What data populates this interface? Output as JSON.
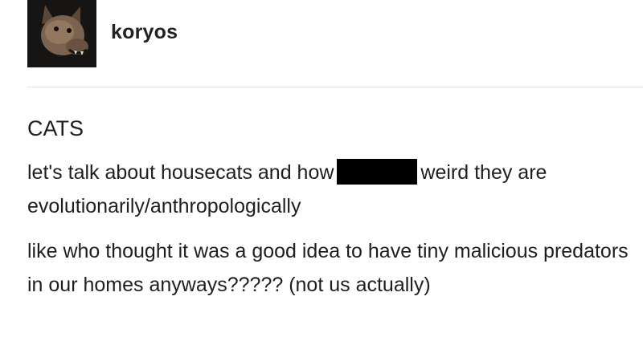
{
  "post": {
    "author": {
      "username": "koryos",
      "avatar_icon": "bat-avatar-icon"
    },
    "heading": "CATS",
    "paragraph1": {
      "before_redaction": "let's talk about housecats and how",
      "after_redaction": "weird they are evolutionarily/anthropologically"
    },
    "paragraph2": "like who thought it was a good idea to have tiny malicious predators in our homes anyways????? (not us actually)"
  },
  "colors": {
    "text": "#1e1e1e",
    "divider": "#e2e2e2",
    "redaction": "#000000"
  }
}
